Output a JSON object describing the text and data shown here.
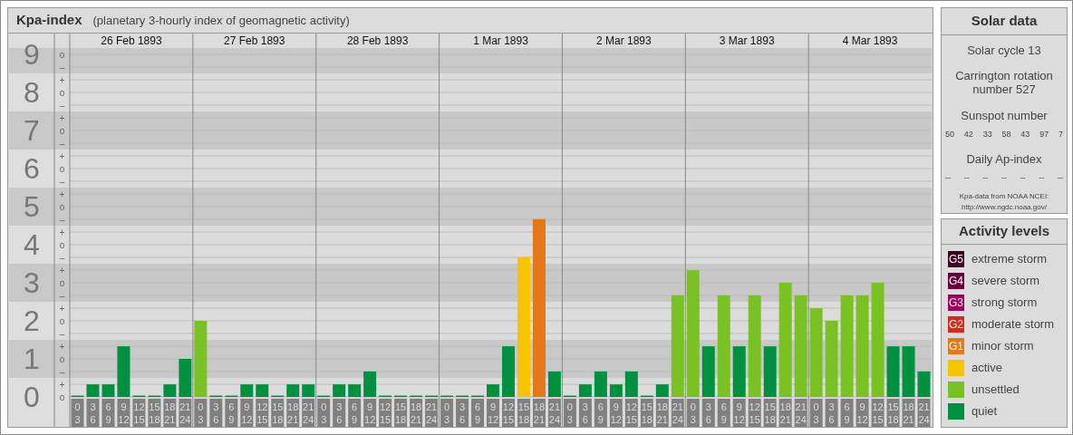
{
  "kpa_panel": {
    "title": "Kpa-index",
    "subtitle": "(planetary 3-hourly index of geomagnetic activity)",
    "dates": [
      "26 Feb 1893",
      "27 Feb 1893",
      "28 Feb 1893",
      "1 Mar 1893",
      "2 Mar 1893",
      "3 Mar 1893",
      "4 Mar 1893"
    ],
    "minor_ticks": [
      "o",
      "–",
      "+",
      "o",
      "–",
      "+",
      "o",
      "–",
      "+",
      "o",
      "–",
      "+",
      "o",
      "–",
      "+",
      "o",
      "–",
      "+",
      "o",
      "–",
      "+",
      "o",
      "–",
      "+",
      "o",
      "–",
      "+",
      "o"
    ],
    "chart_data": {
      "type": "bar",
      "grid": true,
      "bands": [
        {
          "axis": "y",
          "from": 0.5,
          "to": 1.5
        },
        {
          "axis": "y",
          "from": 2.5,
          "to": 3.5
        },
        {
          "axis": "y",
          "from": 4.5,
          "to": 5.5
        },
        {
          "axis": "y",
          "from": 6.5,
          "to": 7.5
        },
        {
          "axis": "y",
          "from": 8.5,
          "to": 9.17
        }
      ],
      "categories": [
        "0 3",
        "3 6",
        "6 9",
        "9 12",
        "12 15",
        "15 18",
        "18 21",
        "21 24",
        "0 3",
        "3 6",
        "6 9",
        "9 12",
        "12 15",
        "15 18",
        "18 21",
        "21 24",
        "0 3",
        "3 6",
        "6 9",
        "9 12",
        "12 15",
        "15 18",
        "18 21",
        "21 24",
        "0 3",
        "3 6",
        "6 9",
        "9 12",
        "12 15",
        "15 18",
        "18 21",
        "21 24",
        "0 3",
        "3 6",
        "6 9",
        "9 12",
        "12 15",
        "15 18",
        "18 21",
        "21 24",
        "0 3",
        "3 6",
        "6 9",
        "9 12",
        "12 15",
        "15 18",
        "18 21",
        "21 24",
        "0 3",
        "3 6",
        "6 9",
        "9 12",
        "12 15",
        "15 18",
        "18 21",
        "21 24"
      ],
      "ylim": [
        0,
        9
      ],
      "yticks": [
        {
          "value": 0,
          "label": "0"
        },
        {
          "value": 1,
          "label": "1"
        },
        {
          "value": 2,
          "label": "2"
        },
        {
          "value": 3,
          "label": "3"
        },
        {
          "value": 4,
          "label": "4"
        },
        {
          "value": 5,
          "label": "5"
        },
        {
          "value": 6,
          "label": "6"
        },
        {
          "value": 7,
          "label": "7"
        },
        {
          "value": 8,
          "label": "8"
        },
        {
          "value": 9,
          "label": "9"
        }
      ],
      "series": [
        {
          "color": "#009140",
          "values": [
            0,
            0.33,
            0.33,
            1.33,
            0,
            0,
            0.33,
            1,
            null,
            0,
            0,
            0.33,
            0.33,
            0,
            0.33,
            0.33,
            0,
            0.33,
            0.33,
            0.67,
            0,
            0,
            0,
            0,
            0,
            0,
            0,
            0.33,
            1.33,
            null,
            null,
            0.67,
            0,
            0.33,
            0.67,
            0.33,
            0.67,
            0,
            0.33,
            null,
            null,
            1.33,
            null,
            1.33,
            null,
            1.33,
            null,
            null,
            null,
            null,
            null,
            null,
            null,
            1.33,
            1.33,
            0.67
          ]
        },
        {
          "color": "#7ac124",
          "values": [
            null,
            null,
            null,
            null,
            null,
            null,
            null,
            null,
            2,
            null,
            null,
            null,
            null,
            null,
            null,
            null,
            null,
            null,
            null,
            null,
            null,
            null,
            null,
            null,
            null,
            null,
            null,
            null,
            null,
            null,
            null,
            null,
            null,
            null,
            null,
            null,
            null,
            null,
            null,
            2.67,
            3.33,
            null,
            2.67,
            null,
            2.67,
            null,
            3,
            2.67,
            2.33,
            2,
            2.67,
            2.67,
            3,
            null,
            null,
            null
          ]
        },
        {
          "color": "#f8c300",
          "values": [
            null,
            null,
            null,
            null,
            null,
            null,
            null,
            null,
            null,
            null,
            null,
            null,
            null,
            null,
            null,
            null,
            null,
            null,
            null,
            null,
            null,
            null,
            null,
            null,
            null,
            null,
            null,
            null,
            null,
            3.67,
            null,
            null,
            null,
            null,
            null,
            null,
            null,
            null,
            null,
            null,
            null,
            null,
            null,
            null,
            null,
            null,
            null,
            null,
            null,
            null,
            null,
            null,
            null,
            null,
            null,
            null
          ]
        },
        {
          "color": "#e3781a",
          "values": [
            null,
            null,
            null,
            null,
            null,
            null,
            null,
            null,
            null,
            null,
            null,
            null,
            null,
            null,
            null,
            null,
            null,
            null,
            null,
            null,
            null,
            null,
            null,
            null,
            null,
            null,
            null,
            null,
            null,
            null,
            4.67,
            null,
            null,
            null,
            null,
            null,
            null,
            null,
            null,
            null,
            null,
            null,
            null,
            null,
            null,
            null,
            null,
            null,
            null,
            null,
            null,
            null,
            null,
            null,
            null,
            null
          ]
        }
      ]
    }
  },
  "solar_data": {
    "title": "Solar data",
    "solar_cycle": "Solar cycle 13",
    "carrington": "Carrington rotation number 527",
    "sunspot_title": "Sunspot number",
    "sunspot_numbers": [
      "50",
      "42",
      "33",
      "58",
      "43",
      "97",
      "7"
    ],
    "ap_title": "Daily Ap-index",
    "ap_values": [
      "--",
      "--",
      "--",
      "--",
      "--",
      "--",
      "--"
    ],
    "source": "Kpa-data from NOAA NCEI:",
    "source_url": "http://www.ngdc.noaa.gov/"
  },
  "activity_levels": {
    "title": "Activity levels",
    "items": [
      {
        "badge": "G5",
        "label": "extreme storm",
        "color": "#3c0020"
      },
      {
        "badge": "G4",
        "label": "severe storm",
        "color": "#6a0040"
      },
      {
        "badge": "G3",
        "label": "strong storm",
        "color": "#a0005c"
      },
      {
        "badge": "G2",
        "label": "moderate storm",
        "color": "#d42a1c"
      },
      {
        "badge": "G1",
        "label": "minor storm",
        "color": "#e3781a"
      },
      {
        "label": "active",
        "color": "#f8c300"
      },
      {
        "label": "unsettled",
        "color": "#7ac124"
      },
      {
        "label": "quiet",
        "color": "#009140"
      }
    ]
  }
}
